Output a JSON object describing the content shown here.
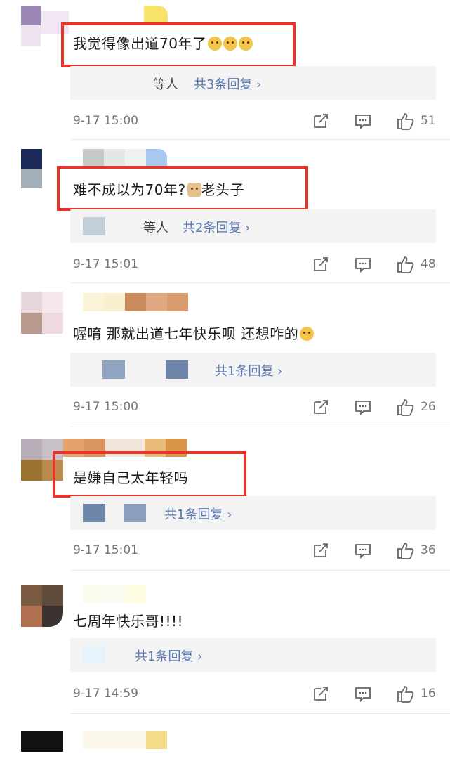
{
  "comments": [
    {
      "text": "我觉得像出道70年了",
      "emojis": [
        "dog-face-icon",
        "dog-face-icon",
        "dog-face-icon"
      ],
      "reply_prefix": "等人",
      "reply_link": "共3条回复 ›",
      "time": "9-17 15:00",
      "likes": "51",
      "highlighted": true
    },
    {
      "text": "难不成以为70年?",
      "emoji_mid": "cat-face-icon",
      "text_after": "老头子",
      "reply_prefix": "等人",
      "reply_link": "共2条回复 ›",
      "time": "9-17 15:01",
      "likes": "48",
      "highlighted": true
    },
    {
      "text": "喔唷 那就出道七年快乐呗 还想咋的",
      "emojis": [
        "dog-face-icon"
      ],
      "reply_prefix": "",
      "reply_link": "共1条回复 ›",
      "time": "9-17 15:00",
      "likes": "26",
      "highlighted": false
    },
    {
      "text": "是嫌自己太年轻吗",
      "reply_prefix": "",
      "reply_link": "共1条回复 ›",
      "time": "9-17 15:01",
      "likes": "36",
      "highlighted": true
    },
    {
      "text": "七周年快乐哥!!!!",
      "reply_prefix": "",
      "reply_link": "共1条回复 ›",
      "time": "9-17 14:59",
      "likes": "16",
      "highlighted": false
    }
  ],
  "colors": {
    "highlight": "#e8352c",
    "link": "#5a7ab1",
    "reply_bg": "#f3f3f4"
  }
}
